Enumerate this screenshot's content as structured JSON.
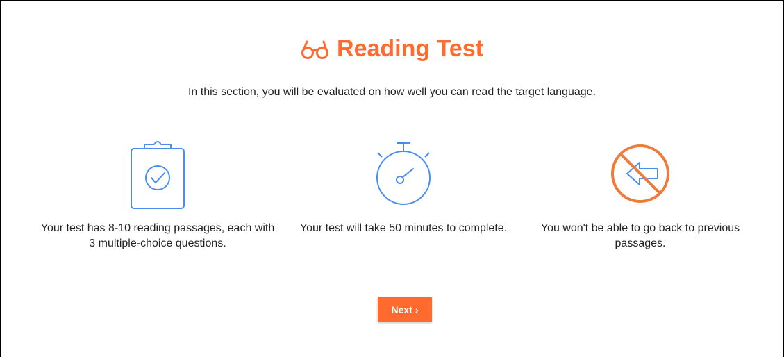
{
  "header": {
    "title": "Reading Test",
    "icon": "glasses-icon"
  },
  "intro": {
    "text": "In this section, you will be evaluated on how well you can read the target language."
  },
  "features": [
    {
      "icon": "clipboard-check-icon",
      "text": "Your test has 8-10 reading passages, each with 3 multiple-choice questions."
    },
    {
      "icon": "stopwatch-icon",
      "text": "Your test will take 50 minutes to complete."
    },
    {
      "icon": "no-back-arrow-icon",
      "text": "You won't be able to go back to previous passages."
    }
  ],
  "actions": {
    "next_label": "Next",
    "next_chevron": "›"
  },
  "colors": {
    "accent": "#ff6a2e",
    "icon_blue": "#4a8df0",
    "icon_orange": "#f07a3c"
  }
}
